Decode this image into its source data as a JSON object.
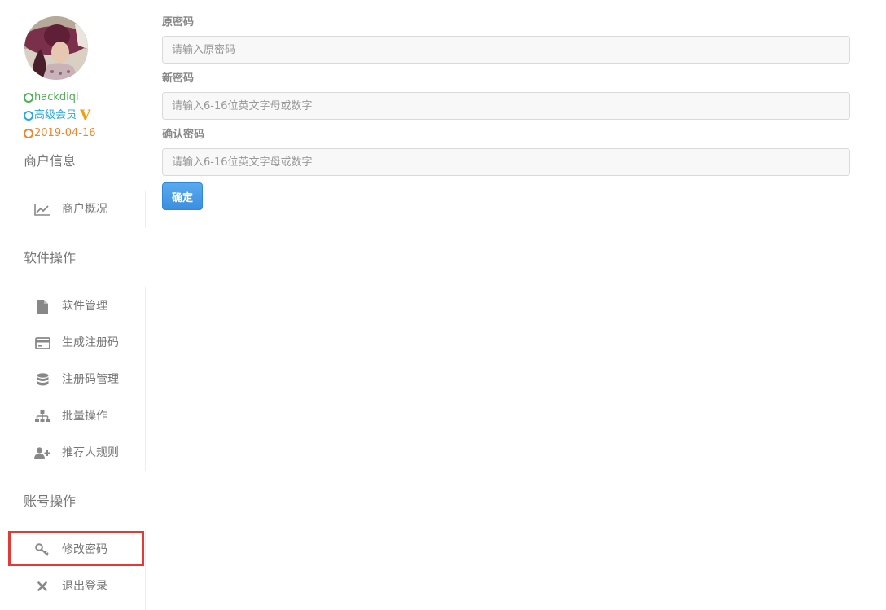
{
  "user": {
    "name": "hackdiqi",
    "level": "高级会员",
    "vip_badge": "V",
    "date": "2019-04-16",
    "name_color": "#4caf50",
    "level_color": "#29a8e0",
    "date_color": "#f0832b"
  },
  "sidebar": {
    "merchant_section": {
      "title": "商户信息",
      "items": [
        {
          "label": "商户概况",
          "icon": "line-chart-icon"
        }
      ]
    },
    "software_section": {
      "title": "软件操作",
      "items": [
        {
          "label": "软件管理",
          "icon": "file-icon"
        },
        {
          "label": "生成注册码",
          "icon": "credit-card-icon"
        },
        {
          "label": "注册码管理",
          "icon": "database-icon"
        },
        {
          "label": "批量操作",
          "icon": "sitemap-icon"
        },
        {
          "label": "推荐人规则",
          "icon": "user-plus-icon"
        }
      ]
    },
    "account_section": {
      "title": "账号操作",
      "items": [
        {
          "label": "修改密码",
          "icon": "key-icon",
          "highlighted": true
        },
        {
          "label": "退出登录",
          "icon": "close-icon"
        }
      ]
    }
  },
  "form": {
    "old_password": {
      "label": "原密码",
      "placeholder": "请输入原密码",
      "value": ""
    },
    "new_password": {
      "label": "新密码",
      "placeholder": "请输入6-16位英文字母或数字",
      "value": ""
    },
    "confirm_password": {
      "label": "确认密码",
      "placeholder": "请输入6-16位英文字母或数字",
      "value": ""
    },
    "submit_label": "确定"
  },
  "colors": {
    "accent": "#3b8fe0",
    "highlight": "#e53935"
  }
}
